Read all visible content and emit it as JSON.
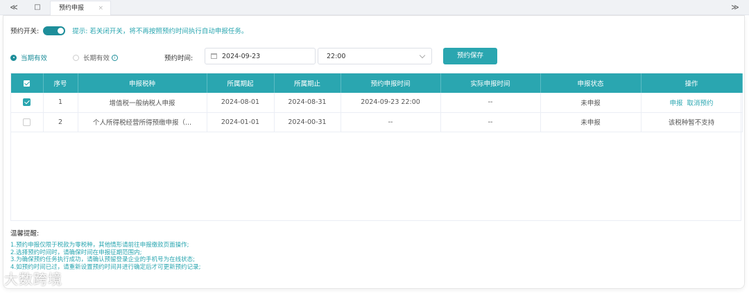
{
  "tabbar": {
    "nav_back_glyph": "≪",
    "nav_forward_glyph": "≫",
    "home_glyph": "□",
    "tab_label": "预约申报",
    "tab_close_glyph": "×"
  },
  "toggle_row": {
    "label": "预约开关:",
    "enabled": true,
    "tip": "提示: 若关闭开关，将不再按照预约时间执行自动申报任务。"
  },
  "validity": {
    "option_current": "当期有效",
    "option_long": "长期有效",
    "info_glyph": "i",
    "selected": "当期有效"
  },
  "schedule": {
    "label": "预约时间:",
    "date_value": "2024-09-23",
    "time_value": "22:00",
    "save_label": "预约保存"
  },
  "table": {
    "headers": [
      "序号",
      "申报税种",
      "所属期起",
      "所属期止",
      "预约申报时间",
      "实际申报时间",
      "申报状态",
      "操作"
    ],
    "rows": [
      {
        "checked": true,
        "no": "1",
        "tax": "增值税一般纳税人申报",
        "start": "2024-08-01",
        "end": "2024-08-31",
        "scheduled": "2024-09-23 22:00",
        "actual": "--",
        "status": "未申报",
        "action_declare": "申报",
        "action_cancel": "取消预约"
      },
      {
        "checked": false,
        "no": "2",
        "tax": "个人所得税经营所得预缴申报（...",
        "start": "2024-01-01",
        "end": "2024-00-31",
        "scheduled": "--",
        "actual": "--",
        "status": "未申报",
        "action_text": "该税种暂不支持"
      }
    ]
  },
  "notes": {
    "title": "温馨提醒:",
    "items": [
      "1.预约申报仅限于税款为零税种，其他情形请前往申报缴款页面操作;",
      "2.选择预约时间时，请确保时间在申报征期范围内;",
      "3.为确保预约任务执行成功，请确认预留登录企业的手机号为在线状态;",
      "4.如预约时间已过，请重新设置预约时间并进行确定后才可更新预约记录;"
    ]
  },
  "watermark": "大数跨境"
}
